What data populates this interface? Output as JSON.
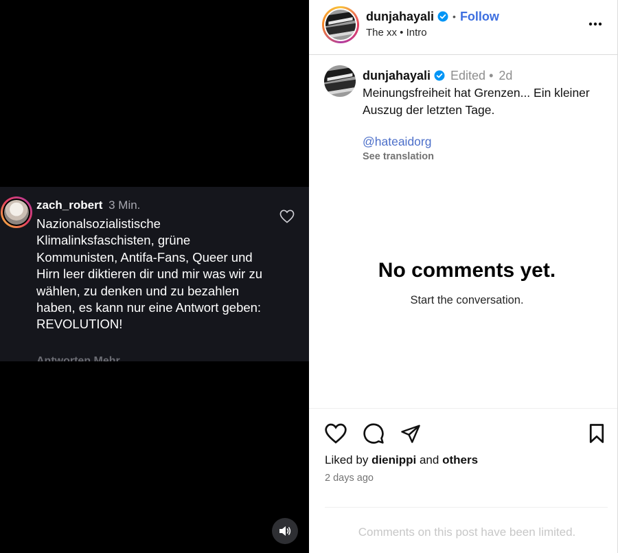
{
  "media": {
    "comment": {
      "username": "zach_robert",
      "time": "3 Min.",
      "text": "Nazionalsozialistische Klimalinksfaschisten, grüne Kommunisten, Antifa-Fans, Queer und Hirn leer diktieren dir und mir was wir zu wählen, zu denken und zu bezahlen haben, es kann nur eine Antwort geben: REVOLUTION!",
      "truncated_next": "Antworten  Mehr"
    }
  },
  "post": {
    "header": {
      "username": "dunjahayali",
      "follow_label": "Follow",
      "separator": "•",
      "audio": "The xx • Intro"
    },
    "caption": {
      "username": "dunjahayali",
      "edited_label": "Edited •",
      "age": "2d",
      "text": "Meinungsfreiheit hat Grenzen... Ein kleiner Auszug der letzten Tage.",
      "mention": "@hateaidorg",
      "see_translation": "See translation"
    },
    "empty": {
      "title": "No comments yet.",
      "subtitle": "Start the conversation."
    },
    "likes": {
      "prefix": "Liked by",
      "user": "dienippi",
      "mid": "and",
      "others": "others"
    },
    "time_ago": "2 days ago",
    "footer_notice": "Comments on this post have been limited."
  },
  "colors": {
    "follow": "#3d6fe0",
    "mention": "#4c6fc9",
    "verified": "#0095f6",
    "comment_card_bg": "#15161c"
  },
  "icons": [
    "heart-icon",
    "verified-icon",
    "more-icon",
    "comment-icon",
    "share-icon",
    "bookmark-icon",
    "speaker-icon"
  ]
}
